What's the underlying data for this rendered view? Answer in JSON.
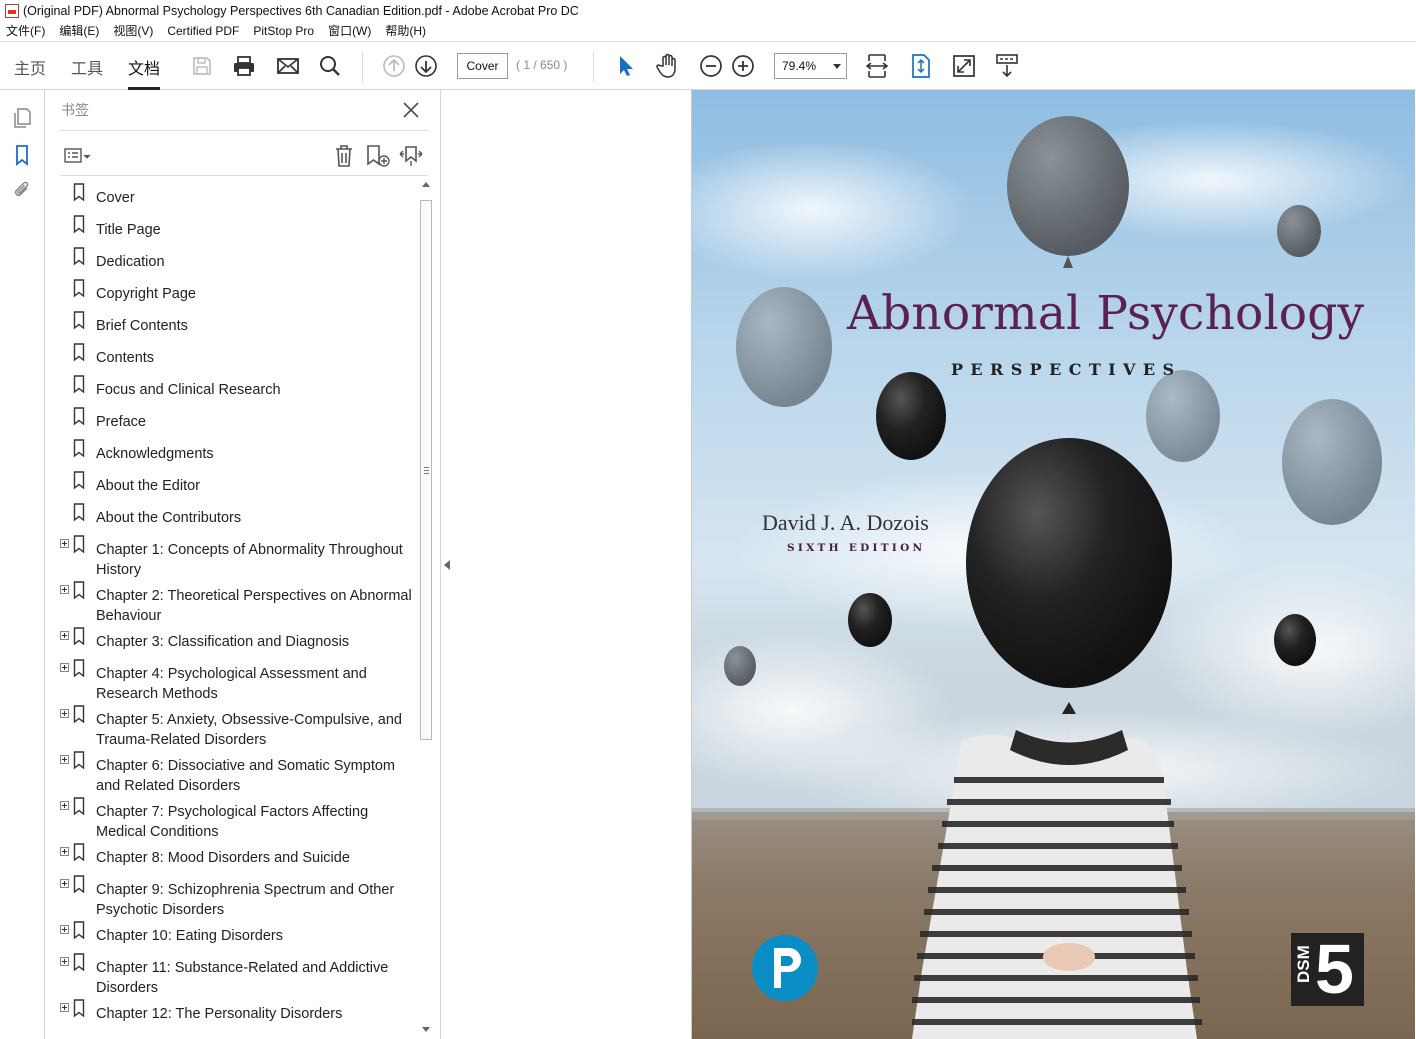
{
  "window": {
    "title": "(Original PDF) Abnormal Psychology Perspectives 6th Canadian Edition.pdf - Adobe Acrobat Pro DC"
  },
  "menu": {
    "items": [
      "文件(F)",
      "编辑(E)",
      "视图(V)",
      "Certified PDF",
      "PitStop Pro",
      "窗口(W)",
      "帮助(H)"
    ]
  },
  "toolbar": {
    "tabs": [
      {
        "label": "主页",
        "active": false
      },
      {
        "label": "工具",
        "active": false
      },
      {
        "label": "文档",
        "active": true
      }
    ],
    "page_input": "Cover",
    "page_count": "( 1 / 650 )",
    "zoom": "79.4%",
    "icons": [
      "save-icon",
      "print-icon",
      "email-icon",
      "search-icon",
      "page-up-icon",
      "page-down-icon",
      "select-cursor-icon",
      "hand-icon",
      "zoom-out-icon",
      "zoom-in-icon",
      "fit-width-icon",
      "fit-page-icon",
      "fullscreen-icon",
      "read-mode-icon"
    ]
  },
  "rail": {
    "icons": [
      "pages-icon",
      "bookmark-icon",
      "attachment-icon"
    ]
  },
  "bookmarks": {
    "header": "书签",
    "items": [
      {
        "label": "Cover",
        "expandable": false
      },
      {
        "label": "Title Page",
        "expandable": false
      },
      {
        "label": "Dedication",
        "expandable": false
      },
      {
        "label": "Copyright Page",
        "expandable": false
      },
      {
        "label": "Brief Contents",
        "expandable": false
      },
      {
        "label": "Contents",
        "expandable": false
      },
      {
        "label": "Focus and Clinical Research",
        "expandable": false
      },
      {
        "label": "Preface",
        "expandable": false
      },
      {
        "label": "Acknowledgments",
        "expandable": false
      },
      {
        "label": "About the Editor",
        "expandable": false
      },
      {
        "label": "About the Contributors",
        "expandable": false
      },
      {
        "label": "Chapter 1: Concepts of Abnormality Throughout History",
        "expandable": true
      },
      {
        "label": "Chapter 2: Theoretical Perspectives on Abnormal Behaviour",
        "expandable": true
      },
      {
        "label": "Chapter 3: Classification and Diagnosis",
        "expandable": true
      },
      {
        "label": "Chapter 4: Psychological Assessment and Research Methods",
        "expandable": true
      },
      {
        "label": "Chapter 5: Anxiety, Obsessive-Compulsive, and Trauma-Related Disorders",
        "expandable": true
      },
      {
        "label": "Chapter 6: Dissociative and Somatic Symptom and Related Disorders",
        "expandable": true
      },
      {
        "label": "Chapter 7: Psychological Factors Affecting Medical Conditions",
        "expandable": true
      },
      {
        "label": "Chapter 8: Mood Disorders and Suicide",
        "expandable": true
      },
      {
        "label": "Chapter 9: Schizophrenia Spectrum and Other Psychotic Disorders",
        "expandable": true
      },
      {
        "label": "Chapter 10: Eating Disorders",
        "expandable": true
      },
      {
        "label": "Chapter 11: Substance-Related and Addictive Disorders",
        "expandable": true
      },
      {
        "label": "Chapter 12: The Personality Disorders",
        "expandable": true
      }
    ]
  },
  "cover": {
    "title": "Abnormal Psychology",
    "subtitle": "PERSPECTIVES",
    "author": "David J. A. Dozois",
    "edition": "SIXTH EDITION",
    "dsm_text": "DSM",
    "dsm_number": "5",
    "colors": {
      "title": "#5a2250",
      "sky": "#a9cbe6",
      "ground": "#8a7a66",
      "pearson": "#0a8cc4"
    }
  }
}
